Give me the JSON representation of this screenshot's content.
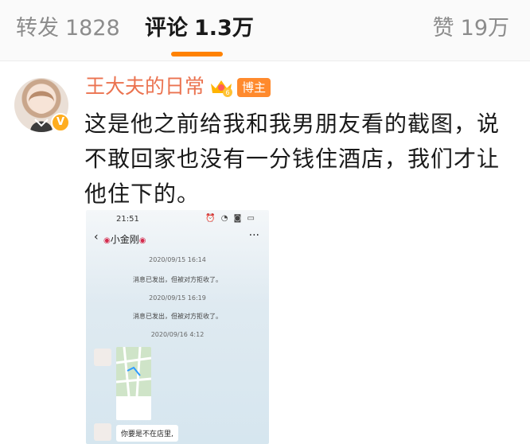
{
  "tabs": {
    "repost": {
      "label": "转发",
      "count": "1828"
    },
    "comments": {
      "label": "评论",
      "count": "1.3万"
    },
    "likes": {
      "label": "赞",
      "count": "19万"
    }
  },
  "colors": {
    "accent": "#ff8200",
    "username": "#eb7350",
    "badge": "#ff8a2d",
    "verified": "#ffad1f"
  },
  "post": {
    "username": "王大夫的日常",
    "badge": "博主",
    "verified_mark": "V",
    "crown_level": "6",
    "text": "这是他之前给我和我男朋友看的截图，说不敢回家也没有一分钱住酒店，我们才让他住下的。"
  },
  "screenshot": {
    "status_time": "21:51",
    "contact_name": "小金刚",
    "messages": [
      {
        "timestamp": "2020/09/15 16:14",
        "system": "消息已发出，但被对方拒收了。"
      },
      {
        "timestamp": "2020/09/15 16:19",
        "system": "消息已发出，但被对方拒收了。"
      },
      {
        "timestamp": "2020/09/16 4:12"
      }
    ],
    "bubble_text": "你要是不在店里,"
  }
}
